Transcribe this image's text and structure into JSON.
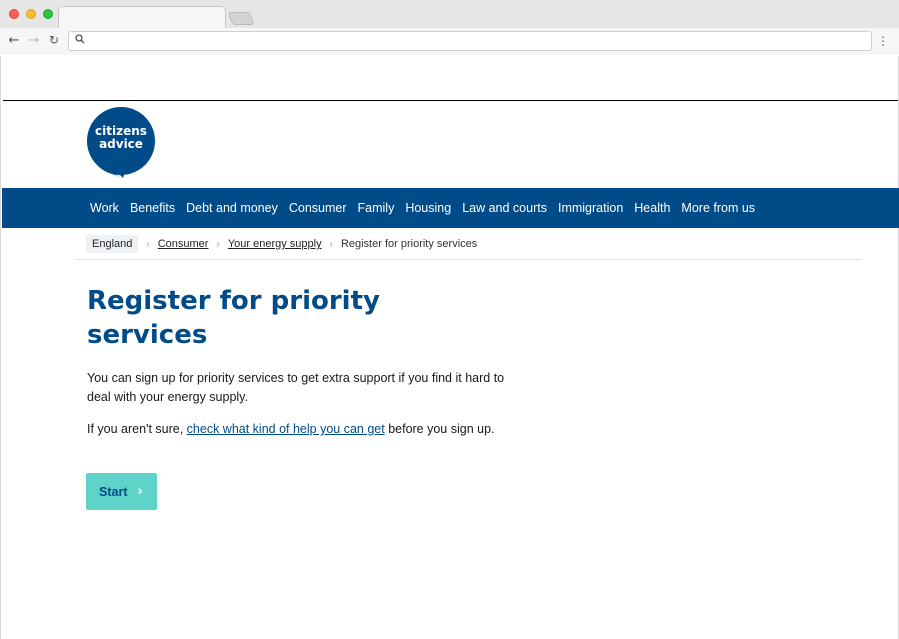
{
  "browser": {
    "icons": {
      "back": "back-arrow-icon",
      "forward": "forward-arrow-icon",
      "reload": "reload-icon",
      "search": "search-icon",
      "menu": "kebab-menu-icon"
    },
    "url": ""
  },
  "logo": {
    "line1": "citizens",
    "line2": "advice",
    "color": "#004b88"
  },
  "nav": {
    "items": [
      "Work",
      "Benefits",
      "Debt and money",
      "Consumer",
      "Family",
      "Housing",
      "Law and courts",
      "Immigration",
      "Health",
      "More from us"
    ],
    "background": "#004b88"
  },
  "breadcrumb": {
    "home": "England",
    "links": [
      "Consumer",
      "Your energy supply"
    ],
    "current": "Register for priority services"
  },
  "main": {
    "title": "Register for priority services",
    "para1": "You can sign up for priority services to get extra support if you find it hard to deal with your energy supply.",
    "para2_before": "If you aren't sure, ",
    "para2_link": "check what kind of help you can get",
    "para2_after": " before you sign up."
  },
  "start_button": {
    "label": "Start",
    "background": "#5fd3c9"
  }
}
